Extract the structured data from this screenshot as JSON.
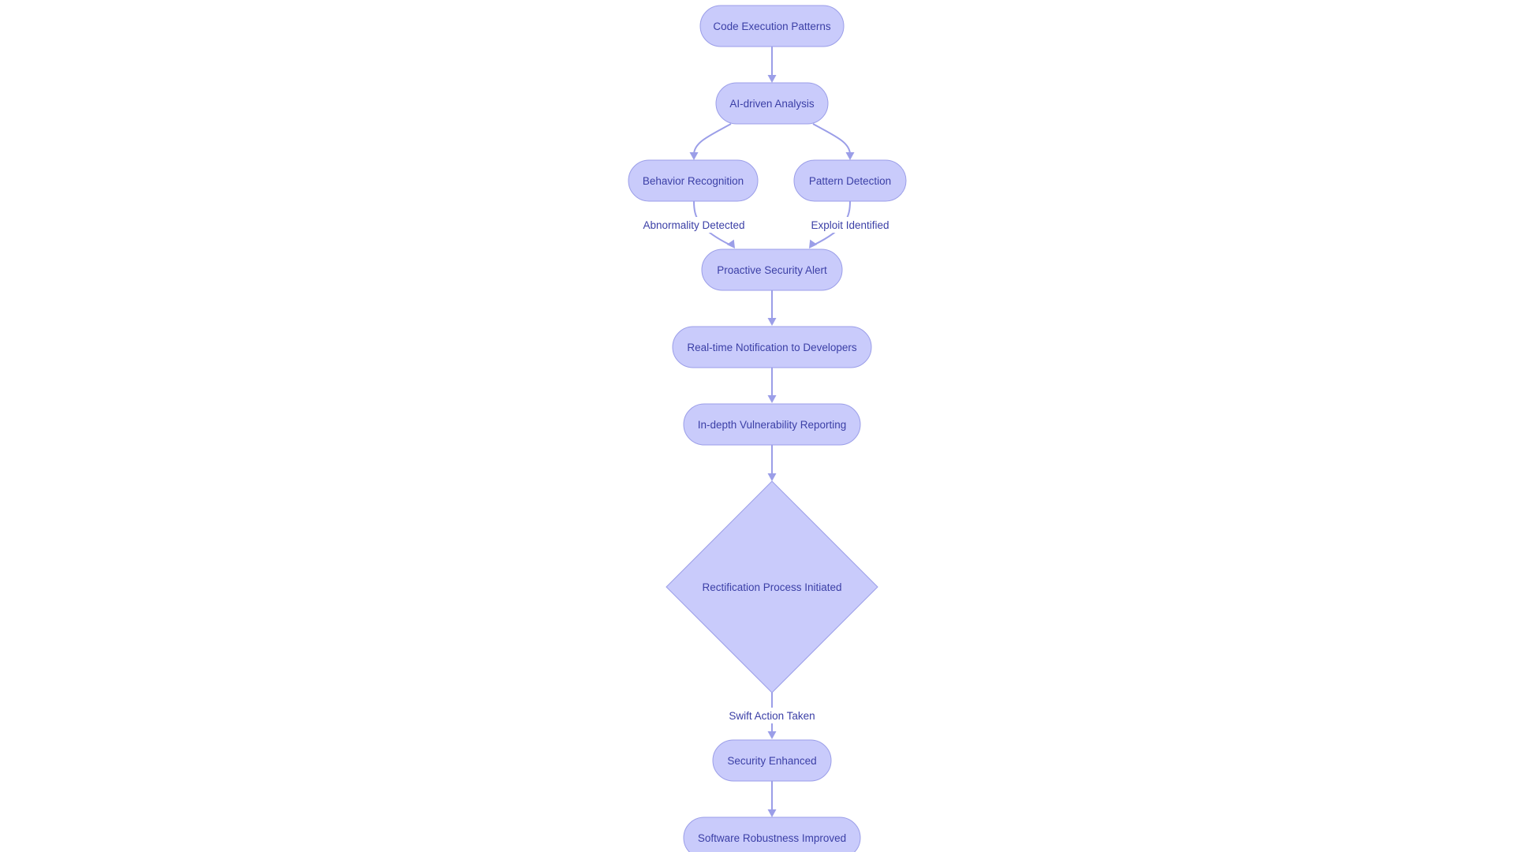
{
  "diagram": {
    "type": "flowchart",
    "direction": "top-down",
    "colors": {
      "node_fill": "#c9cbfb",
      "node_stroke": "#9b9ee8",
      "edge": "#9b9ee8",
      "text": "#3b3fa6",
      "background": "#ffffff"
    },
    "nodes": [
      {
        "id": "code_exec",
        "label": "Code Execution Patterns",
        "shape": "stadium"
      },
      {
        "id": "ai_analysis",
        "label": "AI-driven Analysis",
        "shape": "stadium"
      },
      {
        "id": "behavior",
        "label": "Behavior Recognition",
        "shape": "stadium"
      },
      {
        "id": "pattern",
        "label": "Pattern Detection",
        "shape": "stadium"
      },
      {
        "id": "alert",
        "label": "Proactive Security Alert",
        "shape": "stadium"
      },
      {
        "id": "notify",
        "label": "Real-time Notification to Developers",
        "shape": "stadium"
      },
      {
        "id": "report",
        "label": "In-depth Vulnerability Reporting",
        "shape": "stadium"
      },
      {
        "id": "rectify",
        "label": "Rectification Process Initiated",
        "shape": "diamond"
      },
      {
        "id": "enhanced",
        "label": "Security Enhanced",
        "shape": "stadium"
      },
      {
        "id": "robust",
        "label": "Software Robustness Improved",
        "shape": "stadium"
      }
    ],
    "edges": [
      {
        "from": "code_exec",
        "to": "ai_analysis",
        "label": ""
      },
      {
        "from": "ai_analysis",
        "to": "behavior",
        "label": ""
      },
      {
        "from": "ai_analysis",
        "to": "pattern",
        "label": ""
      },
      {
        "from": "behavior",
        "to": "alert",
        "label": "Abnormality Detected"
      },
      {
        "from": "pattern",
        "to": "alert",
        "label": "Exploit Identified"
      },
      {
        "from": "alert",
        "to": "notify",
        "label": ""
      },
      {
        "from": "notify",
        "to": "report",
        "label": ""
      },
      {
        "from": "report",
        "to": "rectify",
        "label": ""
      },
      {
        "from": "rectify",
        "to": "enhanced",
        "label": "Swift Action Taken"
      },
      {
        "from": "enhanced",
        "to": "robust",
        "label": ""
      }
    ]
  }
}
